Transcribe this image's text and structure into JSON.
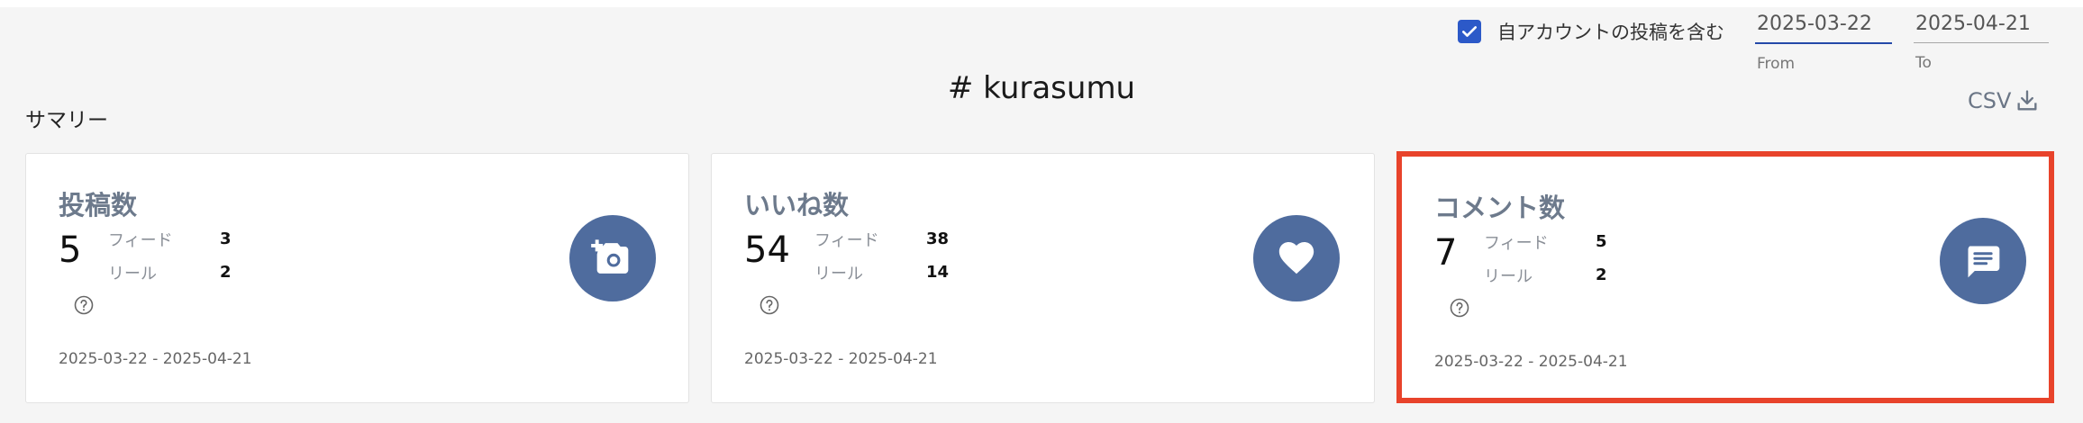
{
  "header": {
    "own_account_label": "自アカウントの投稿を含む",
    "own_account_checked": true,
    "date_from": {
      "value": "2025-03-22",
      "label": "From"
    },
    "date_to": {
      "value": "2025-04-21",
      "label": "To"
    },
    "csv_label": "CSV"
  },
  "hashtag": "# kurasumu",
  "summary": {
    "title": "サマリー",
    "cards": [
      {
        "title": "投稿数",
        "total": "5",
        "breakdown": [
          {
            "label": "フィード",
            "value": "3"
          },
          {
            "label": "リール",
            "value": "2"
          }
        ],
        "range": "2025-03-22 - 2025-04-21",
        "icon": "add-photo-icon"
      },
      {
        "title": "いいね数",
        "total": "54",
        "breakdown": [
          {
            "label": "フィード",
            "value": "38"
          },
          {
            "label": "リール",
            "value": "14"
          }
        ],
        "range": "2025-03-22 - 2025-04-21",
        "icon": "heart-icon"
      },
      {
        "title": "コメント数",
        "total": "7",
        "breakdown": [
          {
            "label": "フィード",
            "value": "5"
          },
          {
            "label": "リール",
            "value": "2"
          }
        ],
        "range": "2025-03-22 - 2025-04-21",
        "icon": "comment-icon"
      }
    ]
  },
  "colors": {
    "accent": "#2c59c8",
    "icon_circle": "#4f6c9e",
    "highlight_border": "#e8432b"
  }
}
